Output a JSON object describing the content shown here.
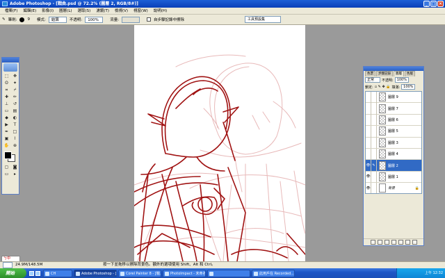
{
  "window": {
    "title": "Adobe Photoshop - [戰曲.psd @ 72.2% (圖層 2, RGB/8#)]"
  },
  "menu": [
    "檔案(F)",
    "編輯(E)",
    "影像(I)",
    "圖層(L)",
    "選取(S)",
    "濾鏡(T)",
    "檢視(V)",
    "視窗(W)",
    "說明(H)"
  ],
  "options": {
    "brush_label": "筆刷:",
    "brush_size": "9",
    "mode_label": "模式:",
    "mode_value": "結算",
    "opacity_label": "不透明:",
    "opacity_value": "100%",
    "flow_label": "流量:",
    "auto_erase": "自步驟記錄中擦除",
    "palette_well": "工具預設集"
  },
  "layers_panel": {
    "tabs": [
      "色票",
      "步驟記錄",
      "圖層",
      "色版"
    ],
    "blend_mode": "正常",
    "opacity_label": "不透明:",
    "opacity": "100%",
    "lock_label": "鎖定:",
    "fill_label": "填滿:",
    "fill": "100%",
    "layers": [
      {
        "name": "圖層 9",
        "visible": false,
        "selected": false
      },
      {
        "name": "圖層 7",
        "visible": false,
        "selected": false
      },
      {
        "name": "圖層 6",
        "visible": false,
        "selected": false
      },
      {
        "name": "圖層 5",
        "visible": false,
        "selected": false
      },
      {
        "name": "圖層 3",
        "visible": false,
        "selected": false
      },
      {
        "name": "圖層 4",
        "visible": false,
        "selected": false
      },
      {
        "name": "圖層 2",
        "visible": true,
        "selected": true
      },
      {
        "name": "圖層 1",
        "visible": true,
        "selected": false
      },
      {
        "name": "背景",
        "visible": true,
        "selected": false,
        "background": true
      }
    ]
  },
  "status": {
    "ime": "ㄅ中",
    "zoom": "72.2%",
    "doc": "24.9M/148.5M",
    "hint": "按一下並拖移以擦除背景色。額外的選項使用 Shift、Alt 和 Ctrl。"
  },
  "taskbar": {
    "start": "開始",
    "tasks": [
      {
        "label": "CH",
        "active": false
      },
      {
        "label": "Adobe Photoshop - [",
        "active": true
      },
      {
        "label": "Corel Painter 8 - [戰...",
        "active": false
      },
      {
        "label": "PhotoImpact - 未命名...",
        "active": false
      },
      {
        "label": "",
        "active": false
      },
      {
        "label": "此用戶在 Recorded...",
        "active": false
      }
    ],
    "clock": "上午 12:32"
  }
}
